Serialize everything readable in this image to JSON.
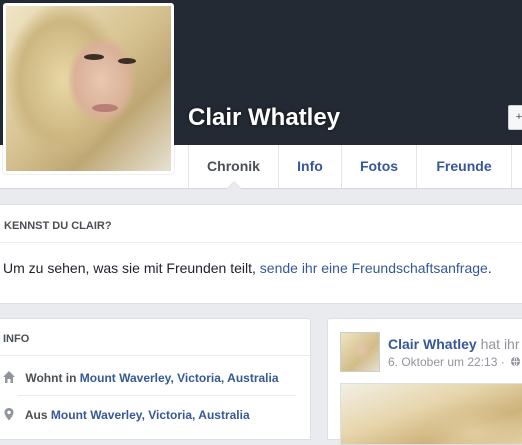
{
  "profile": {
    "name": "Clair Whatley",
    "cover_button_label": "+"
  },
  "tabs": [
    {
      "label": "Chronik",
      "active": true
    },
    {
      "label": "Info",
      "active": false
    },
    {
      "label": "Fotos",
      "active": false
    },
    {
      "label": "Freunde",
      "active": false
    }
  ],
  "know_box": {
    "title": "KENNST DU CLAIR?",
    "text_prefix": "Um zu sehen, was sie mit Freunden teilt,",
    "link_text": "sende ihr eine Freundschaftsanfrage",
    "text_suffix": "."
  },
  "info": {
    "title": "INFO",
    "rows": [
      {
        "icon": "home-icon",
        "prefix": "Wohnt in",
        "link": "Mount Waverley, Victoria, Australia"
      },
      {
        "icon": "location-pin-icon",
        "prefix": "Aus",
        "link": "Mount Waverley, Victoria, Australia"
      }
    ]
  },
  "post": {
    "author": "Clair Whatley",
    "action": "hat ihr",
    "timestamp": "6. Oktober um 22:13 ·",
    "privacy_icon": "globe-icon"
  },
  "colors": {
    "cover": "#232a33",
    "link": "#365899",
    "page_background": "#e9ebee"
  }
}
